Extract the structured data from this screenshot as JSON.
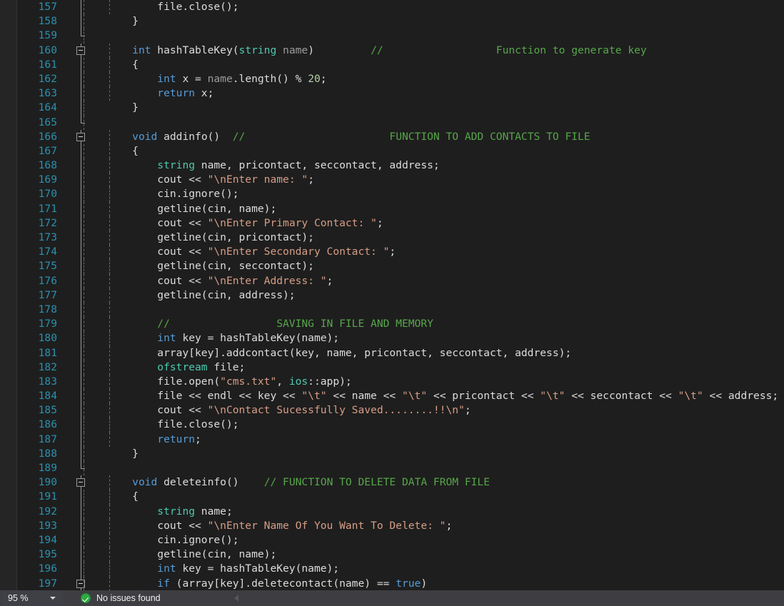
{
  "editor": {
    "language": "cpp",
    "first_visible_line": 157,
    "theme": {
      "background": "#1e1e1e",
      "gutter_background": "#252526",
      "line_number": "#2b91af",
      "keyword": "#569cd6",
      "type": "#4ec9b0",
      "comment": "#57a64a",
      "string": "#d69d85",
      "identifier": "#dcdcdc",
      "parameter": "#9b9b9b",
      "number": "#b5cea8",
      "status_bar": "#3e3e42"
    },
    "lines": [
      {
        "n": 157,
        "depth": 2,
        "guides": [
          0,
          1
        ],
        "outline": "line",
        "tokens": [
          {
            "t": "        file.close();",
            "c": "id"
          }
        ]
      },
      {
        "n": 158,
        "depth": 1,
        "guides": [
          0
        ],
        "outline": "line",
        "tokens": [
          {
            "t": "    }",
            "c": "op"
          }
        ]
      },
      {
        "n": 159,
        "depth": 0,
        "guides": [
          0
        ],
        "outline": "endcap",
        "tokens": []
      },
      {
        "n": 160,
        "depth": 1,
        "guides": [
          1
        ],
        "outline": "box",
        "tokens": [
          {
            "t": "    ",
            "c": "op"
          },
          {
            "t": "int",
            "c": "kw"
          },
          {
            "t": " hashTableKey(",
            "c": "id"
          },
          {
            "t": "string",
            "c": "type"
          },
          {
            "t": " ",
            "c": "id"
          },
          {
            "t": "name",
            "c": "par"
          },
          {
            "t": ")",
            "c": "id"
          },
          {
            "t": "         ",
            "c": "op"
          },
          {
            "t": "//",
            "c": "cmt"
          },
          {
            "t": "                  Function to generate key",
            "c": "cmt"
          }
        ]
      },
      {
        "n": 161,
        "depth": 1,
        "guides": [
          0,
          1
        ],
        "outline": "line",
        "tokens": [
          {
            "t": "    {",
            "c": "op"
          }
        ]
      },
      {
        "n": 162,
        "depth": 2,
        "guides": [
          0,
          1
        ],
        "outline": "line",
        "tokens": [
          {
            "t": "        ",
            "c": "op"
          },
          {
            "t": "int",
            "c": "kw"
          },
          {
            "t": " x = ",
            "c": "id"
          },
          {
            "t": "name",
            "c": "par"
          },
          {
            "t": ".length() % ",
            "c": "id"
          },
          {
            "t": "20",
            "c": "num"
          },
          {
            "t": ";",
            "c": "id"
          }
        ]
      },
      {
        "n": 163,
        "depth": 2,
        "guides": [
          0,
          1
        ],
        "outline": "line",
        "tokens": [
          {
            "t": "        ",
            "c": "op"
          },
          {
            "t": "return",
            "c": "kw"
          },
          {
            "t": " x;",
            "c": "id"
          }
        ]
      },
      {
        "n": 164,
        "depth": 1,
        "guides": [
          0
        ],
        "outline": "line",
        "tokens": [
          {
            "t": "    }",
            "c": "op"
          }
        ]
      },
      {
        "n": 165,
        "depth": 0,
        "guides": [
          0
        ],
        "outline": "endcap",
        "tokens": []
      },
      {
        "n": 166,
        "depth": 1,
        "guides": [
          1
        ],
        "outline": "box",
        "tokens": [
          {
            "t": "    ",
            "c": "op"
          },
          {
            "t": "void",
            "c": "kw"
          },
          {
            "t": " addinfo()",
            "c": "id"
          },
          {
            "t": "  ",
            "c": "op"
          },
          {
            "t": "//",
            "c": "cmt"
          },
          {
            "t": "                       FUNCTION TO ADD CONTACTS TO FILE",
            "c": "cmt"
          }
        ]
      },
      {
        "n": 167,
        "depth": 1,
        "guides": [
          0,
          1
        ],
        "outline": "line",
        "tokens": [
          {
            "t": "    {",
            "c": "op"
          }
        ]
      },
      {
        "n": 168,
        "depth": 2,
        "guides": [
          0,
          1
        ],
        "outline": "line",
        "tokens": [
          {
            "t": "        ",
            "c": "op"
          },
          {
            "t": "string",
            "c": "type"
          },
          {
            "t": " name, pricontact, seccontact, address;",
            "c": "id"
          }
        ]
      },
      {
        "n": 169,
        "depth": 2,
        "guides": [
          0,
          1
        ],
        "outline": "line",
        "tokens": [
          {
            "t": "        cout << ",
            "c": "id"
          },
          {
            "t": "\"\\nEnter name: \"",
            "c": "str"
          },
          {
            "t": ";",
            "c": "id"
          }
        ]
      },
      {
        "n": 170,
        "depth": 2,
        "guides": [
          0,
          1
        ],
        "outline": "line",
        "tokens": [
          {
            "t": "        cin.ignore();",
            "c": "id"
          }
        ]
      },
      {
        "n": 171,
        "depth": 2,
        "guides": [
          0,
          1
        ],
        "outline": "line",
        "tokens": [
          {
            "t": "        getline(cin, name);",
            "c": "id"
          }
        ]
      },
      {
        "n": 172,
        "depth": 2,
        "guides": [
          0,
          1
        ],
        "outline": "line",
        "tokens": [
          {
            "t": "        cout << ",
            "c": "id"
          },
          {
            "t": "\"\\nEnter Primary Contact: \"",
            "c": "str"
          },
          {
            "t": ";",
            "c": "id"
          }
        ]
      },
      {
        "n": 173,
        "depth": 2,
        "guides": [
          0,
          1
        ],
        "outline": "line",
        "tokens": [
          {
            "t": "        getline(cin, pricontact);",
            "c": "id"
          }
        ]
      },
      {
        "n": 174,
        "depth": 2,
        "guides": [
          0,
          1
        ],
        "outline": "line",
        "tokens": [
          {
            "t": "        cout << ",
            "c": "id"
          },
          {
            "t": "\"\\nEnter Secondary Contact: \"",
            "c": "str"
          },
          {
            "t": ";",
            "c": "id"
          }
        ]
      },
      {
        "n": 175,
        "depth": 2,
        "guides": [
          0,
          1
        ],
        "outline": "line",
        "tokens": [
          {
            "t": "        getline(cin, seccontact);",
            "c": "id"
          }
        ]
      },
      {
        "n": 176,
        "depth": 2,
        "guides": [
          0,
          1
        ],
        "outline": "line",
        "tokens": [
          {
            "t": "        cout << ",
            "c": "id"
          },
          {
            "t": "\"\\nEnter Address: \"",
            "c": "str"
          },
          {
            "t": ";",
            "c": "id"
          }
        ]
      },
      {
        "n": 177,
        "depth": 2,
        "guides": [
          0,
          1
        ],
        "outline": "line",
        "tokens": [
          {
            "t": "        getline(cin, address);",
            "c": "id"
          }
        ]
      },
      {
        "n": 178,
        "depth": 2,
        "guides": [
          0,
          1
        ],
        "outline": "line",
        "tokens": []
      },
      {
        "n": 179,
        "depth": 2,
        "guides": [
          0,
          1
        ],
        "outline": "line",
        "tokens": [
          {
            "t": "        ",
            "c": "op"
          },
          {
            "t": "//",
            "c": "cmt"
          },
          {
            "t": "                 SAVING IN FILE AND MEMORY",
            "c": "cmt"
          }
        ]
      },
      {
        "n": 180,
        "depth": 2,
        "guides": [
          0,
          1
        ],
        "outline": "line",
        "tokens": [
          {
            "t": "        ",
            "c": "op"
          },
          {
            "t": "int",
            "c": "kw"
          },
          {
            "t": " key = hashTableKey(name);",
            "c": "id"
          }
        ]
      },
      {
        "n": 181,
        "depth": 2,
        "guides": [
          0,
          1
        ],
        "outline": "line",
        "tokens": [
          {
            "t": "        array[key].addcontact(key, name, pricontact, seccontact, address);",
            "c": "id"
          }
        ]
      },
      {
        "n": 182,
        "depth": 2,
        "guides": [
          0,
          1
        ],
        "outline": "line",
        "tokens": [
          {
            "t": "        ",
            "c": "op"
          },
          {
            "t": "ofstream",
            "c": "type"
          },
          {
            "t": " file;",
            "c": "id"
          }
        ]
      },
      {
        "n": 183,
        "depth": 2,
        "guides": [
          0,
          1
        ],
        "outline": "line",
        "tokens": [
          {
            "t": "        file.open(",
            "c": "id"
          },
          {
            "t": "\"cms.txt\"",
            "c": "str"
          },
          {
            "t": ", ",
            "c": "id"
          },
          {
            "t": "ios",
            "c": "type"
          },
          {
            "t": "::app);",
            "c": "id"
          }
        ]
      },
      {
        "n": 184,
        "depth": 2,
        "guides": [
          0,
          1
        ],
        "outline": "line",
        "tokens": [
          {
            "t": "        file << endl << key << ",
            "c": "id"
          },
          {
            "t": "\"\\t\"",
            "c": "str"
          },
          {
            "t": " << name << ",
            "c": "id"
          },
          {
            "t": "\"\\t\"",
            "c": "str"
          },
          {
            "t": " << pricontact << ",
            "c": "id"
          },
          {
            "t": "\"\\t\"",
            "c": "str"
          },
          {
            "t": " << seccontact << ",
            "c": "id"
          },
          {
            "t": "\"\\t\"",
            "c": "str"
          },
          {
            "t": " << address;",
            "c": "id"
          }
        ]
      },
      {
        "n": 185,
        "depth": 2,
        "guides": [
          0,
          1
        ],
        "outline": "line",
        "tokens": [
          {
            "t": "        cout << ",
            "c": "id"
          },
          {
            "t": "\"\\nContact Sucessfully Saved........!!\\n\"",
            "c": "str"
          },
          {
            "t": ";",
            "c": "id"
          }
        ]
      },
      {
        "n": 186,
        "depth": 2,
        "guides": [
          0,
          1
        ],
        "outline": "line",
        "tokens": [
          {
            "t": "        file.close();",
            "c": "id"
          }
        ]
      },
      {
        "n": 187,
        "depth": 2,
        "guides": [
          0,
          1
        ],
        "outline": "line",
        "tokens": [
          {
            "t": "        ",
            "c": "op"
          },
          {
            "t": "return",
            "c": "kw"
          },
          {
            "t": ";",
            "c": "id"
          }
        ]
      },
      {
        "n": 188,
        "depth": 1,
        "guides": [
          0
        ],
        "outline": "line",
        "tokens": [
          {
            "t": "    }",
            "c": "op"
          }
        ]
      },
      {
        "n": 189,
        "depth": 0,
        "guides": [
          0
        ],
        "outline": "endcap",
        "tokens": []
      },
      {
        "n": 190,
        "depth": 1,
        "guides": [
          1
        ],
        "outline": "box",
        "tokens": [
          {
            "t": "    ",
            "c": "op"
          },
          {
            "t": "void",
            "c": "kw"
          },
          {
            "t": " deleteinfo()",
            "c": "id"
          },
          {
            "t": "    ",
            "c": "op"
          },
          {
            "t": "// FUNCTION TO DELETE DATA FROM FILE",
            "c": "cmt"
          }
        ]
      },
      {
        "n": 191,
        "depth": 1,
        "guides": [
          0,
          1
        ],
        "outline": "line",
        "tokens": [
          {
            "t": "    {",
            "c": "op"
          }
        ]
      },
      {
        "n": 192,
        "depth": 2,
        "guides": [
          0,
          1
        ],
        "outline": "line",
        "tokens": [
          {
            "t": "        ",
            "c": "op"
          },
          {
            "t": "string",
            "c": "type"
          },
          {
            "t": " name;",
            "c": "id"
          }
        ]
      },
      {
        "n": 193,
        "depth": 2,
        "guides": [
          0,
          1
        ],
        "outline": "line",
        "tokens": [
          {
            "t": "        cout << ",
            "c": "id"
          },
          {
            "t": "\"\\nEnter Name Of You Want To Delete: \"",
            "c": "str"
          },
          {
            "t": ";",
            "c": "id"
          }
        ]
      },
      {
        "n": 194,
        "depth": 2,
        "guides": [
          0,
          1
        ],
        "outline": "line",
        "tokens": [
          {
            "t": "        cin.ignore();",
            "c": "id"
          }
        ]
      },
      {
        "n": 195,
        "depth": 2,
        "guides": [
          0,
          1
        ],
        "outline": "line",
        "tokens": [
          {
            "t": "        getline(cin, name);",
            "c": "id"
          }
        ]
      },
      {
        "n": 196,
        "depth": 2,
        "guides": [
          0,
          1
        ],
        "outline": "line",
        "tokens": [
          {
            "t": "        ",
            "c": "op"
          },
          {
            "t": "int",
            "c": "kw"
          },
          {
            "t": " key = hashTableKey(name);",
            "c": "id"
          }
        ]
      },
      {
        "n": 197,
        "depth": 2,
        "guides": [
          0,
          1
        ],
        "outline": "box",
        "tokens": [
          {
            "t": "        ",
            "c": "op"
          },
          {
            "t": "if",
            "c": "kw"
          },
          {
            "t": " (array[key].deletecontact(name) == ",
            "c": "id"
          },
          {
            "t": "true",
            "c": "kw"
          },
          {
            "t": ")",
            "c": "id"
          }
        ]
      }
    ]
  },
  "status_bar": {
    "zoom_level": "95 %",
    "zoom_caret_icon": "chevron-down-icon",
    "issues_icon": "check-circle-icon",
    "issues_text": "No issues found",
    "nav_back_icon": "triangle-left-icon"
  }
}
